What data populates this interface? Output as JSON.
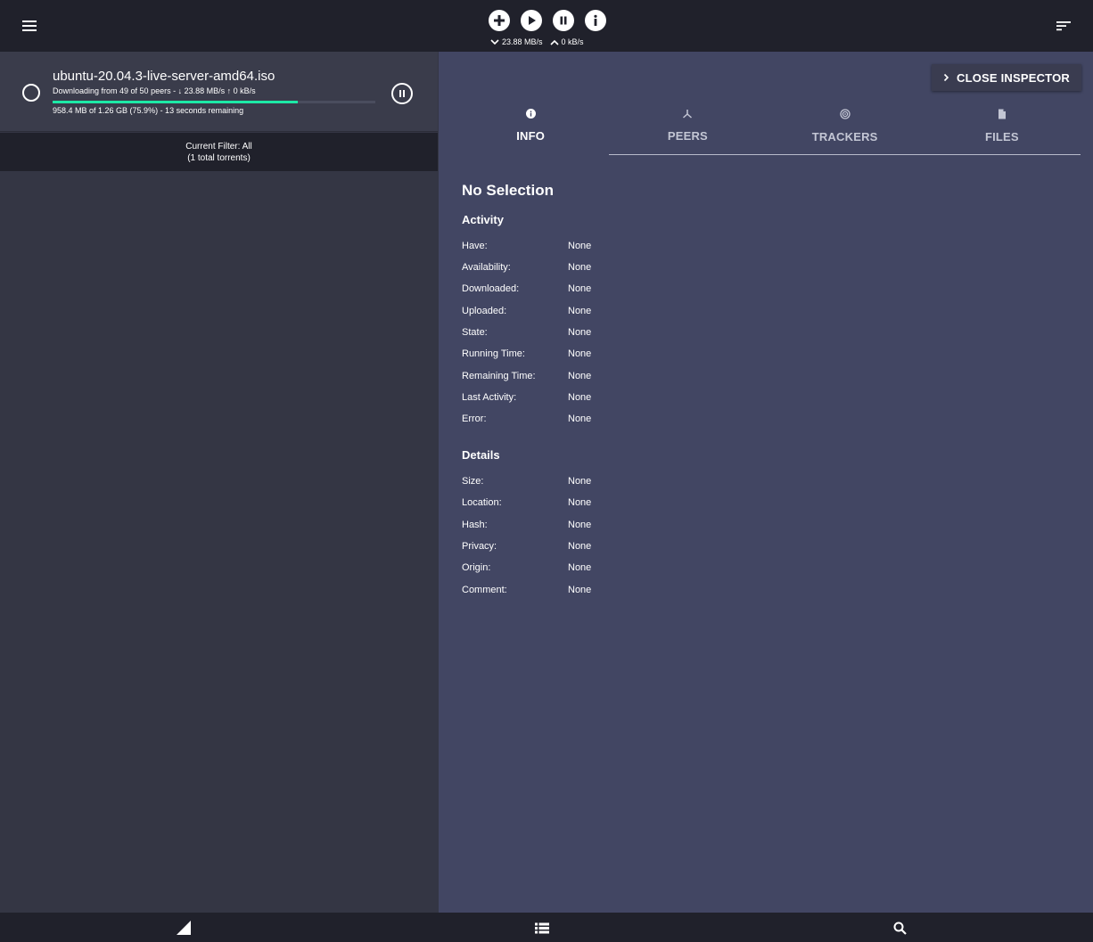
{
  "toolbar": {
    "icons": [
      "menu-icon",
      "add-icon",
      "play-icon",
      "pause-icon",
      "info-icon",
      "sort-icon"
    ],
    "download_speed": "23.88 MB/s",
    "upload_speed": "0 kB/s"
  },
  "torrent": {
    "name": "ubuntu-20.04.3-live-server-amd64.iso",
    "peers_line": "Downloading from 49 of 50 peers - ↓ 23.88 MB/s ↑ 0 kB/s",
    "size_line": "958.4 MB of 1.26 GB (75.9%) - 13 seconds remaining",
    "progress_percent": 75.9,
    "progress_color": "#1de9a6"
  },
  "filter": {
    "line1": "Current Filter: All",
    "line2": "(1 total torrents)"
  },
  "inspector": {
    "close_label": "CLOSE INSPECTOR",
    "tabs": [
      {
        "label": "INFO",
        "icon": "info-icon"
      },
      {
        "label": "PEERS",
        "icon": "peers-icon"
      },
      {
        "label": "TRACKERS",
        "icon": "trackers-icon"
      },
      {
        "label": "FILES",
        "icon": "file-icon"
      }
    ],
    "active_tab": "INFO",
    "title": "No Selection",
    "activity_heading": "Activity",
    "activity": [
      {
        "label": "Have:",
        "value": "None"
      },
      {
        "label": "Availability:",
        "value": "None"
      },
      {
        "label": "Downloaded:",
        "value": "None"
      },
      {
        "label": "Uploaded:",
        "value": "None"
      },
      {
        "label": "State:",
        "value": "None"
      },
      {
        "label": "Running Time:",
        "value": "None"
      },
      {
        "label": "Remaining Time:",
        "value": "None"
      },
      {
        "label": "Last Activity:",
        "value": "None"
      },
      {
        "label": "Error:",
        "value": "None"
      }
    ],
    "details_heading": "Details",
    "details": [
      {
        "label": "Size:",
        "value": "None"
      },
      {
        "label": "Location:",
        "value": "None"
      },
      {
        "label": "Hash:",
        "value": "None"
      },
      {
        "label": "Privacy:",
        "value": "None"
      },
      {
        "label": "Origin:",
        "value": "None"
      },
      {
        "label": "Comment:",
        "value": "None"
      }
    ]
  },
  "bottombar": {
    "icons": [
      "signal-icon",
      "list-icon",
      "search-icon"
    ]
  },
  "colors": {
    "topbar": "#20212b",
    "left_pane": "#343644",
    "inspector": "#424663",
    "accent": "#1de9a6"
  }
}
